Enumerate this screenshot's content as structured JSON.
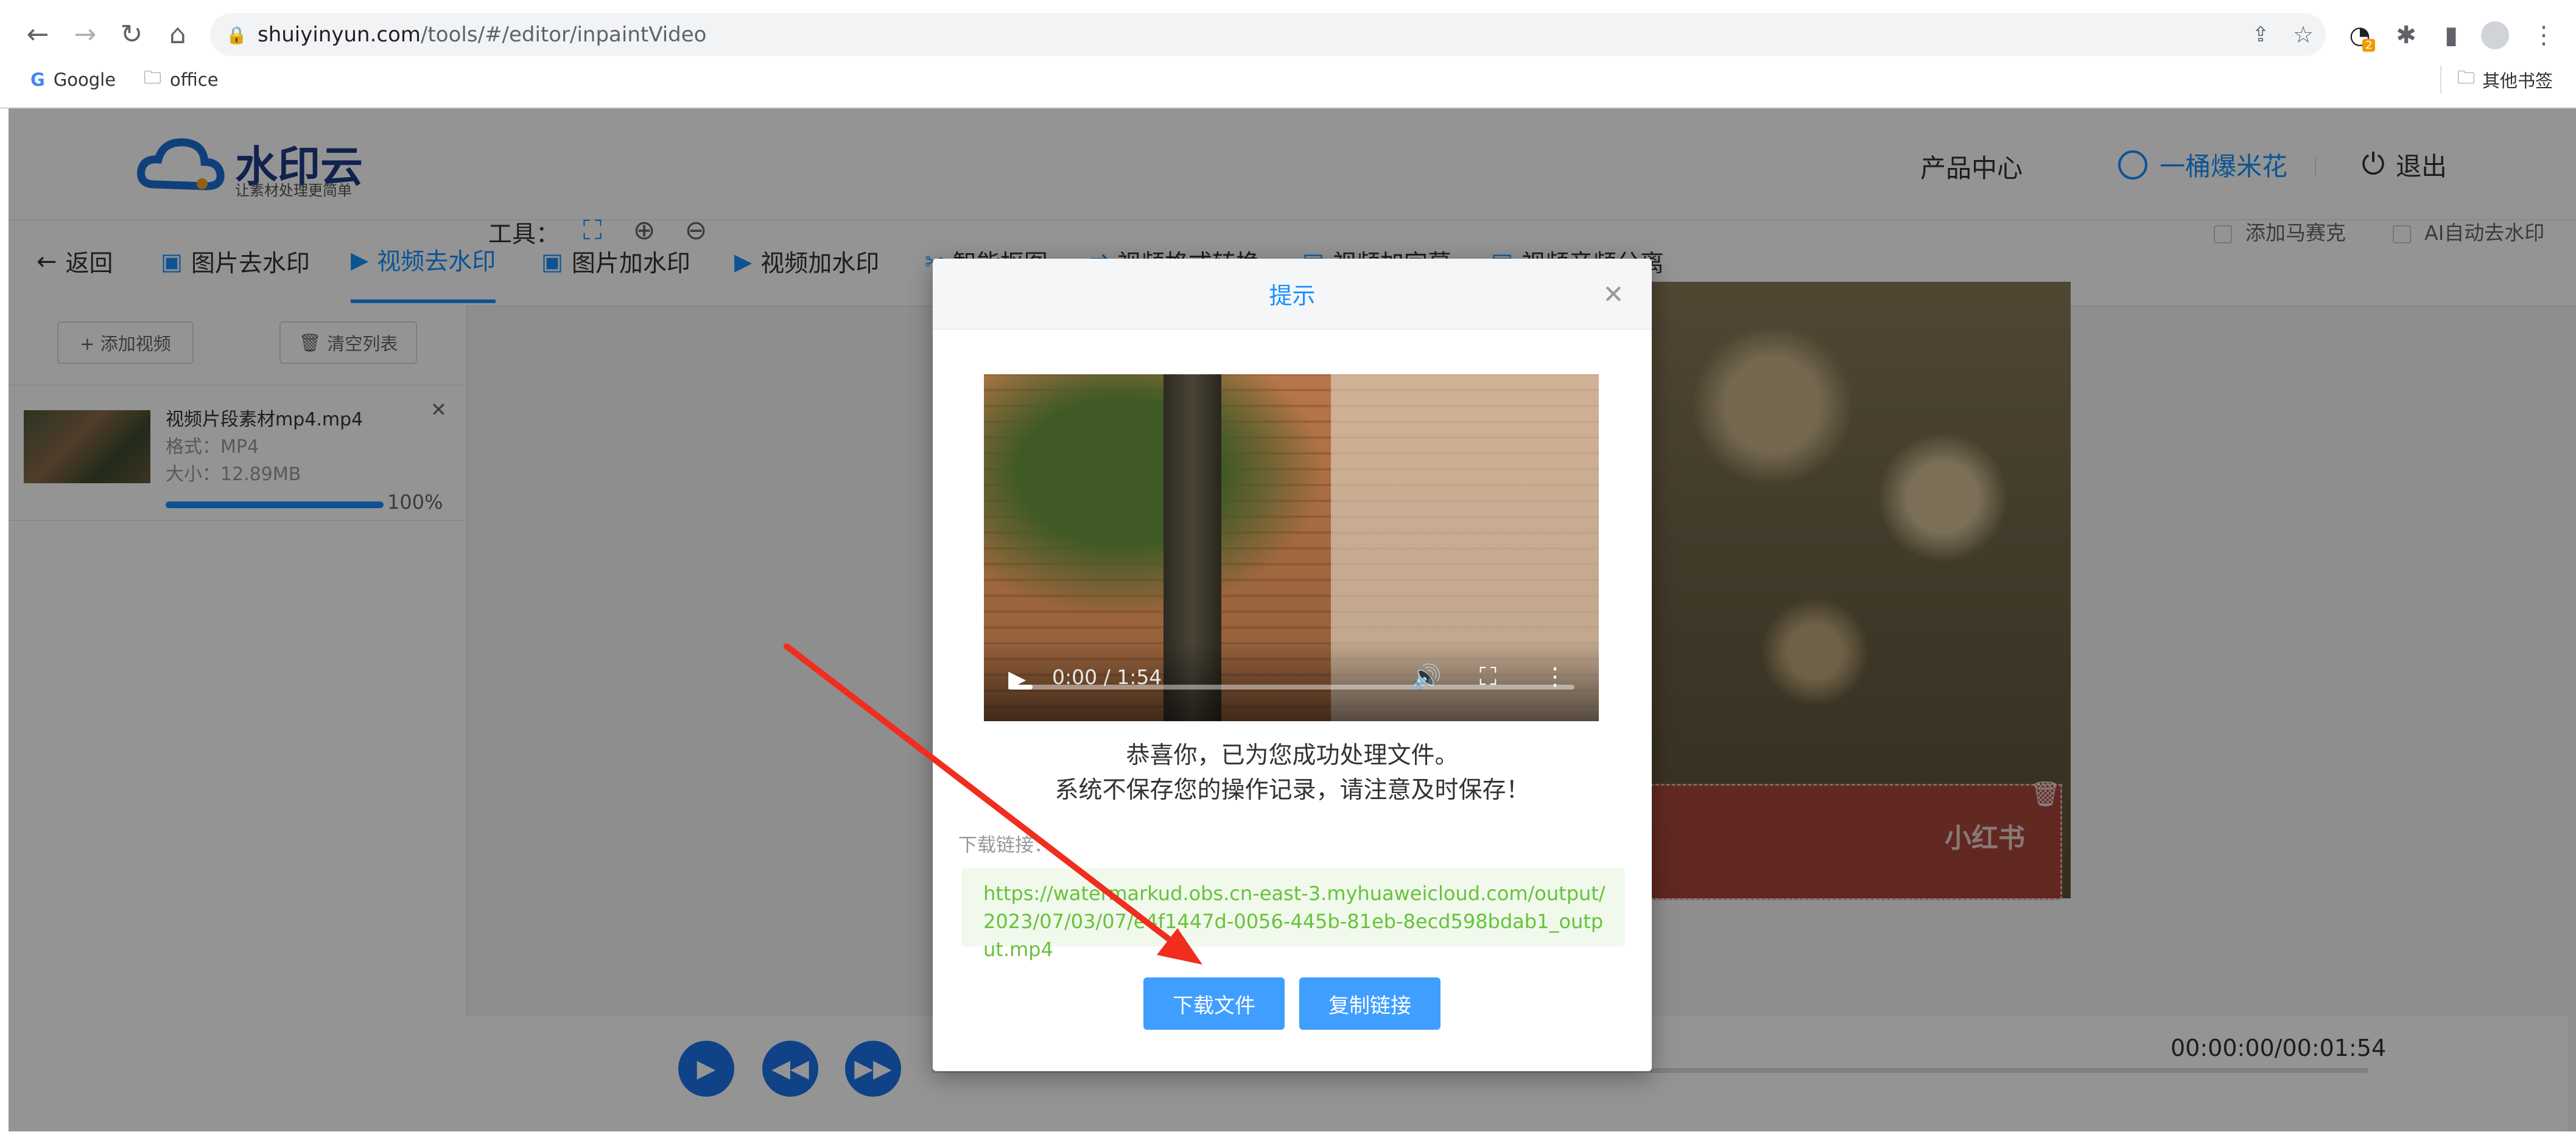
{
  "browser": {
    "url_host": "shuiyinyun.com",
    "url_path": "/tools/#/editor/inpaintVideo",
    "extension_badge": "2",
    "bookmarks": [
      "Google",
      "office"
    ],
    "other_bookmarks": "其他书签"
  },
  "header": {
    "logo_text": "水印云",
    "logo_sub": "让素材处理更简单",
    "product_center": "产品中心",
    "username": "一桶爆米花",
    "logout": "退出"
  },
  "tabs": [
    {
      "label": "返回"
    },
    {
      "label": "图片去水印"
    },
    {
      "label": "视频去水印"
    },
    {
      "label": "图片加水印"
    },
    {
      "label": "视频加水印"
    },
    {
      "label": "智能抠图"
    },
    {
      "label": "视频格式转换"
    },
    {
      "label": "视频加字幕"
    },
    {
      "label": "视频音频分离"
    }
  ],
  "left_panel": {
    "add_video": "+ 添加视频",
    "clear_list": "清空列表",
    "file": {
      "name": "视频片段素材mp4.mp4",
      "format": "格式：MP4",
      "size": "大小：12.89MB",
      "progress_text": "100%",
      "progress": 1.0
    }
  },
  "toolbar": {
    "label": "工具：",
    "option_mosaic": "添加马赛克",
    "option_ai": "AI自动去水印"
  },
  "player": {
    "time": "00:00:00/00:01:54",
    "watermark_text": "小红书"
  },
  "modal": {
    "title": "提示",
    "video_time": "0:00 / 1:54",
    "message_line1": "恭喜你，已为您成功处理文件。",
    "message_line2": "系统不保存您的操作记录，请注意及时保存！",
    "download_label": "下载链接：",
    "download_url": "https://watermarkud.obs.cn-east-3.myhuaweicloud.com/output/2023/07/03/07/e4f1447d-0056-445b-81eb-8ecd598bdab1_output.mp4",
    "btn_download": "下载文件",
    "btn_copy": "复制链接"
  },
  "colors": {
    "accent": "#1890ff",
    "button": "#409eff",
    "link_green": "#67c23a",
    "annotation_arrow": "#f02d1e"
  }
}
